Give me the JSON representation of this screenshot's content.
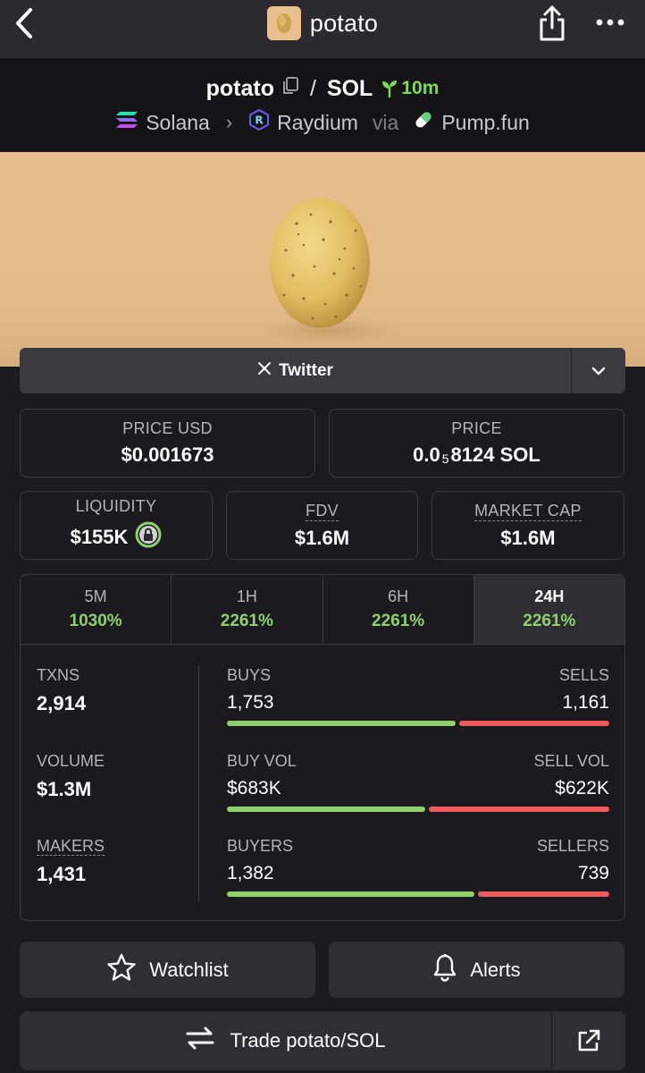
{
  "topbar": {
    "title": "potato",
    "icons": [
      "back-chevron-icon",
      "potato-thumb-icon",
      "share-icon",
      "more-icon"
    ]
  },
  "pair": {
    "base": "potato",
    "quote": "SOL",
    "age": "10m",
    "chain": "Solana",
    "dex": "Raydium",
    "via_label": "via",
    "launchpad": "Pump.fun"
  },
  "twitter": {
    "label": "Twitter"
  },
  "prices": {
    "price_usd_label": "PRICE USD",
    "price_usd_value": "$0.001673",
    "price_label": "PRICE",
    "price_prefix": "0.0",
    "price_zeros": "5",
    "price_suffix": "8124 SOL"
  },
  "metrics": {
    "liquidity_label": "LIQUIDITY",
    "liquidity_value": "$155K",
    "fdv_label": "FDV",
    "fdv_value": "$1.6M",
    "mcap_label": "MARKET CAP",
    "mcap_value": "$1.6M"
  },
  "timeframes": [
    {
      "label": "5M",
      "value": "1030%"
    },
    {
      "label": "1H",
      "value": "2261%"
    },
    {
      "label": "6H",
      "value": "2261%"
    },
    {
      "label": "24H",
      "value": "2261%",
      "active": true
    }
  ],
  "stats": {
    "txns_label": "TXNS",
    "txns_value": "2,914",
    "volume_label": "VOLUME",
    "volume_value": "$1.3M",
    "makers_label": "MAKERS",
    "makers_value": "1,431",
    "buys_label": "BUYS",
    "buys_value": "1,753",
    "sells_label": "SELLS",
    "sells_value": "1,161",
    "buyvol_label": "BUY VOL",
    "buyvol_value": "$683K",
    "sellvol_label": "SELL VOL",
    "sellvol_value": "$622K",
    "buyers_label": "BUYERS",
    "buyers_value": "1,382",
    "sellers_label": "SELLERS",
    "sellers_value": "739",
    "buys_fraction": 0.602,
    "buyvol_fraction": 0.523,
    "buyers_fraction": 0.652
  },
  "actions": {
    "watchlist": "Watchlist",
    "alerts": "Alerts",
    "trade": "Trade potato/SOL"
  },
  "colors": {
    "background": "#1b1b1f",
    "green": "#8fd16a",
    "red": "#f05a5a",
    "banner": "#e7be8d"
  }
}
